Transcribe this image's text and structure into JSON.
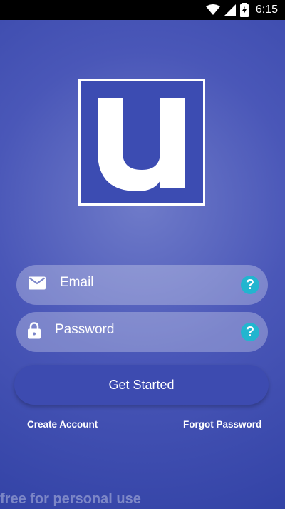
{
  "status_bar": {
    "time": "6:15",
    "icons": [
      "wifi-icon",
      "signal-icon",
      "battery-icon"
    ]
  },
  "logo": {
    "letter": "u",
    "icon": "u-logo-icon",
    "background_color": "#3c4cb2",
    "border_color": "#ffffff"
  },
  "form": {
    "email": {
      "placeholder": "Email",
      "icon": "mail-icon",
      "help": "?"
    },
    "password": {
      "placeholder": "Password",
      "icon": "lock-icon",
      "help": "?"
    }
  },
  "actions": {
    "get_started": "Get Started",
    "create_account": "Create Account",
    "forgot_password": "Forgot Password"
  },
  "watermark": "free for personal use",
  "colors": {
    "background": "#4a57b8",
    "button": "#3d4bb0",
    "help_icon": "#22b5cf"
  }
}
